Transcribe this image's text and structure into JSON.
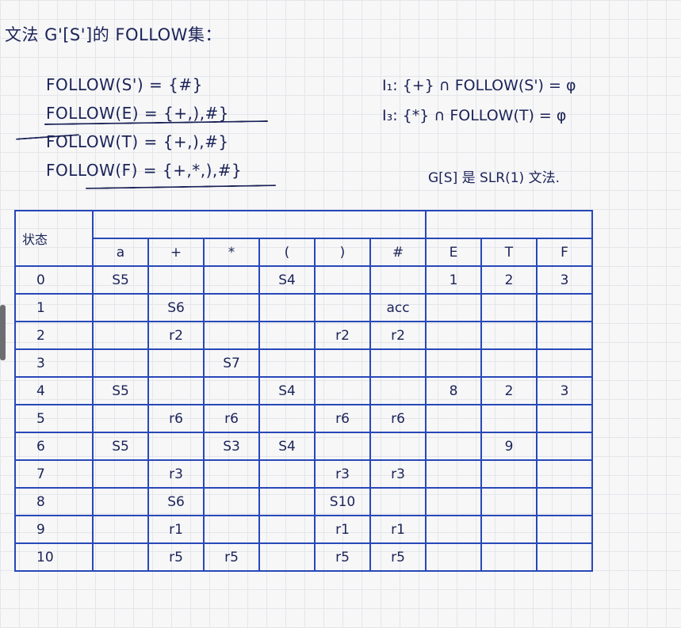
{
  "title": "文法 G'[S']的 FOLLOW集：",
  "follow_sets": [
    "FOLLOW(S') = {#}",
    "FOLLOW(E) = {+,),#}",
    "FOLLOW(T) = {+,),#}",
    "FOLLOW(F) = {+,*,),#}"
  ],
  "conflict_checks": [
    "I₁:  {+} ∩ FOLLOW(S') = φ",
    "I₃:  {*} ∩ FOLLOW(T) = φ"
  ],
  "conclusion": "G[S] 是 SLR(1) 文法.",
  "table": {
    "corner_label": "状态",
    "columns": [
      "a",
      "+",
      "*",
      "(",
      ")",
      "#",
      "E",
      "T",
      "F"
    ],
    "rows": [
      {
        "state": "0",
        "cells": [
          "S5",
          "",
          "",
          "S4",
          "",
          "",
          "1",
          "2",
          "3"
        ]
      },
      {
        "state": "1",
        "cells": [
          "",
          "S6",
          "",
          "",
          "",
          "acc",
          "",
          "",
          ""
        ]
      },
      {
        "state": "2",
        "cells": [
          "",
          "r2",
          "",
          "",
          "r2",
          "r2",
          "",
          "",
          ""
        ]
      },
      {
        "state": "3",
        "cells": [
          "",
          "",
          "S7",
          "",
          "",
          "",
          "",
          "",
          ""
        ]
      },
      {
        "state": "4",
        "cells": [
          "S5",
          "",
          "",
          "S4",
          "",
          "",
          "8",
          "2",
          "3"
        ]
      },
      {
        "state": "5",
        "cells": [
          "",
          "r6",
          "r6",
          "",
          "r6",
          "r6",
          "",
          "",
          ""
        ]
      },
      {
        "state": "6",
        "cells": [
          "S5",
          "",
          "S3",
          "S4",
          "",
          "",
          "",
          "9",
          ""
        ]
      },
      {
        "state": "7",
        "cells": [
          "",
          "r3",
          "",
          "",
          "r3",
          "r3",
          "",
          "",
          ""
        ]
      },
      {
        "state": "8",
        "cells": [
          "",
          "S6",
          "",
          "",
          "S10",
          "",
          "",
          "",
          ""
        ]
      },
      {
        "state": "9",
        "cells": [
          "",
          "r1",
          "",
          "",
          "r1",
          "r1",
          "",
          "",
          ""
        ]
      },
      {
        "state": "10",
        "cells": [
          "",
          "r5",
          "r5",
          "",
          "r5",
          "r5",
          "",
          "",
          ""
        ]
      }
    ]
  }
}
